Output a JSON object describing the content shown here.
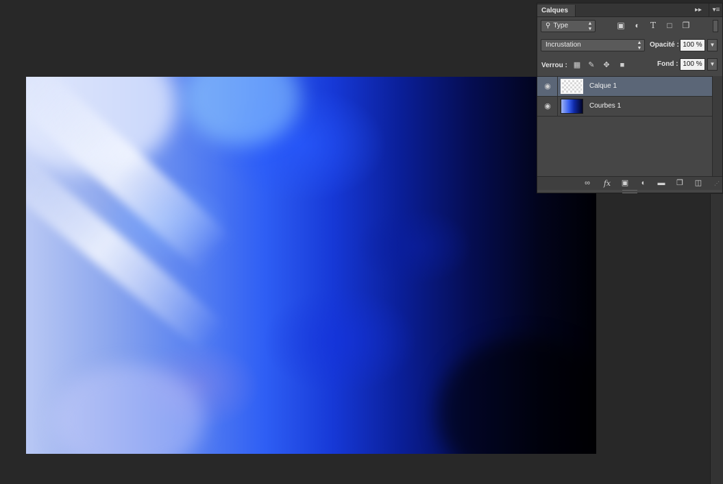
{
  "panel": {
    "tab_label": "Calques",
    "collapse_icon": "double-chevron-right-icon",
    "menu_icon": "panel-menu-icon",
    "filter": {
      "kind_label": "Type",
      "icons": [
        "image-filter-icon",
        "adjustment-filter-icon",
        "type-filter-icon",
        "shape-filter-icon",
        "smart-object-filter-icon"
      ]
    },
    "blend": {
      "mode": "Incrustation",
      "opacity_label": "Opacité :",
      "opacity_value": "100 %"
    },
    "lock": {
      "label": "Verrou :",
      "icons": [
        "lock-transparency-icon",
        "lock-pixels-icon",
        "lock-position-icon",
        "lock-all-icon"
      ],
      "fill_label": "Fond :",
      "fill_value": "100 %"
    },
    "layers": [
      {
        "name": "Calque 1",
        "selected": true,
        "visible": true,
        "thumbnail": "transparent"
      },
      {
        "name": "Courbes 1",
        "selected": false,
        "visible": true,
        "thumbnail": "image"
      }
    ],
    "footer_icons": [
      "link-layers-icon",
      "fx-icon",
      "mask-icon",
      "adjustment-layer-icon",
      "folder-icon",
      "new-layer-icon",
      "trash-icon"
    ]
  },
  "colors": {
    "app_background": "#282828",
    "panel_background": "#464646",
    "selected_layer": "#5b6677"
  }
}
